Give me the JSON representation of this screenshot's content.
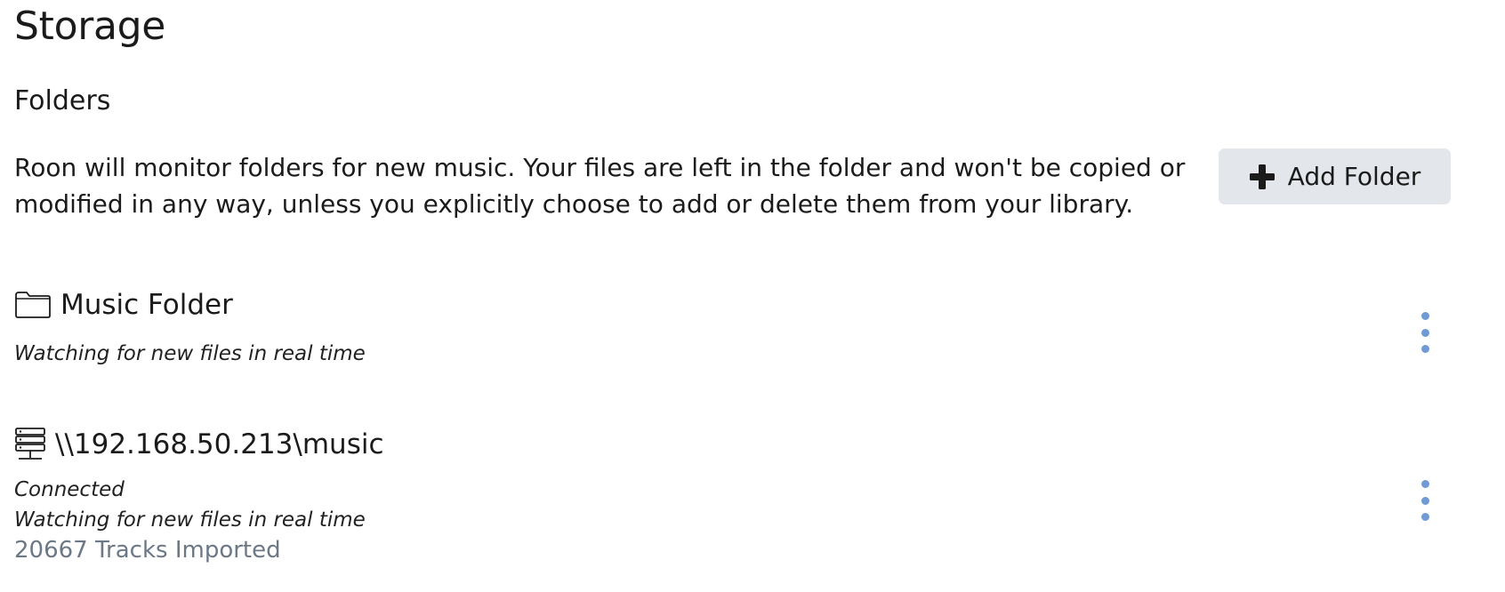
{
  "page": {
    "title": "Storage"
  },
  "folders_section": {
    "title": "Folders",
    "description": "Roon will monitor folders for new music. Your files are left in the folder and won't be copied or modified in any way, unless you explicitly choose to add or delete them from your library.",
    "add_button_label": "Add Folder",
    "add_button_icon": "plus-icon"
  },
  "folders": [
    {
      "icon": "folder-icon",
      "name": "Music Folder",
      "status_lines": [
        "Watching for new files in real time"
      ],
      "tracks_imported": ""
    },
    {
      "icon": "server-icon",
      "name": "\\\\192.168.50.213\\music",
      "status_lines": [
        "Connected",
        "Watching for new files in real time"
      ],
      "tracks_imported": "20667 Tracks Imported"
    }
  ],
  "colors": {
    "button_bg": "#e3e6ea",
    "more_dots": "#6f9ad6",
    "count_text": "#6c7886"
  }
}
